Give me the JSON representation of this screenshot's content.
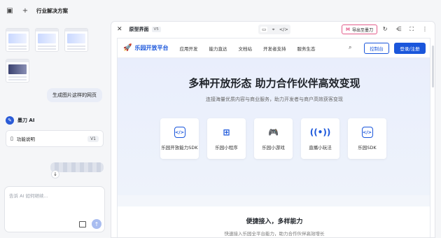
{
  "topbar": {
    "title": "行业解决方案"
  },
  "left": {
    "user_message": "生成图片这样的网页",
    "agent_name": "墨刀 AI",
    "file_card": {
      "name": "功能说明",
      "version": "V1"
    },
    "composer_placeholder": "告诉 AI 如何继续..."
  },
  "preview": {
    "title": "原型界面",
    "version": "V5",
    "modes": [
      "▭",
      "⌖",
      "</>"
    ],
    "export_label": "导出至墨刀",
    "export_icon": "M"
  },
  "site": {
    "brand": "乐园开放平台",
    "nav": [
      "应用开发",
      "能力直达",
      "文档站",
      "开发者支持",
      "服务生态"
    ],
    "console_label": "控制台",
    "login_label": "登录/注册",
    "hero_title": "多种开放形态 助力合作伙伴高效变现",
    "hero_sub": "连接海量优质内容与商业服务，助力开发者与商户高效获客变现",
    "cards": [
      {
        "icon": "</>",
        "label": "乐园开放能力SDK"
      },
      {
        "icon": "⊞",
        "label": "乐园小程序"
      },
      {
        "icon": "🎮",
        "label": "乐园小游戏"
      },
      {
        "icon": "((•))",
        "label": "直播小玩法"
      },
      {
        "icon": "</>",
        "label": "乐园SDK"
      }
    ],
    "section_title": "便捷接入，多样能力",
    "section_sub": "快速接入乐园全平台能力，助力合作伙伴高效增长"
  },
  "colors": {
    "brand": "#1a56db",
    "export_accent": "#e35d8c"
  }
}
